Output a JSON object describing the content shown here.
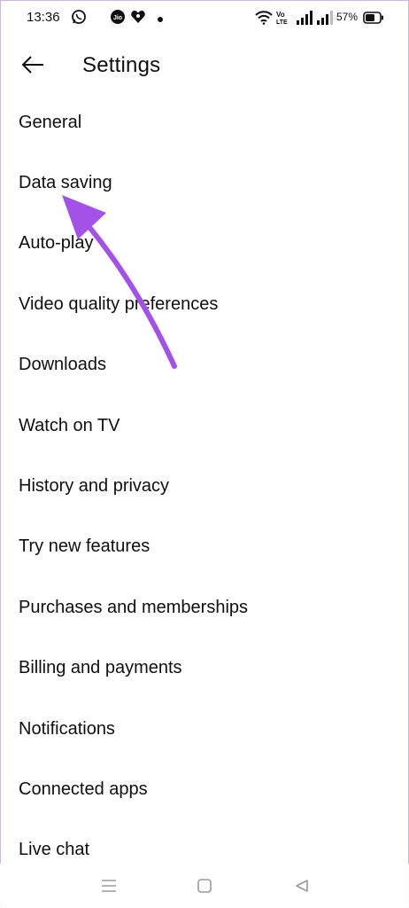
{
  "status_bar": {
    "time": "13:36",
    "battery_percent": "57%",
    "icons": [
      "whatsapp-icon",
      "jio-icon",
      "heart-app-icon",
      "dot-icon",
      "wifi-icon",
      "volte-icon",
      "signal-icon",
      "signal-icon-2",
      "battery-icon"
    ]
  },
  "header": {
    "title": "Settings",
    "back_icon": "arrow-left-icon"
  },
  "settings": {
    "items": [
      {
        "label": "General"
      },
      {
        "label": "Data saving"
      },
      {
        "label": "Auto-play"
      },
      {
        "label": "Video quality preferences"
      },
      {
        "label": "Downloads"
      },
      {
        "label": "Watch on TV"
      },
      {
        "label": "History and privacy"
      },
      {
        "label": "Try new features"
      },
      {
        "label": "Purchases and memberships"
      },
      {
        "label": "Billing and payments"
      },
      {
        "label": "Notifications"
      },
      {
        "label": "Connected apps"
      },
      {
        "label": "Live chat"
      }
    ]
  },
  "annotation": {
    "color": "#a352e8",
    "target": "Data saving"
  },
  "nav_bar": {
    "icons": [
      "menu-icon",
      "home-square-icon",
      "back-triangle-icon"
    ]
  },
  "colors": {
    "text": "#0f0f0f",
    "background": "#ffffff",
    "arrow": "#a352e8"
  }
}
